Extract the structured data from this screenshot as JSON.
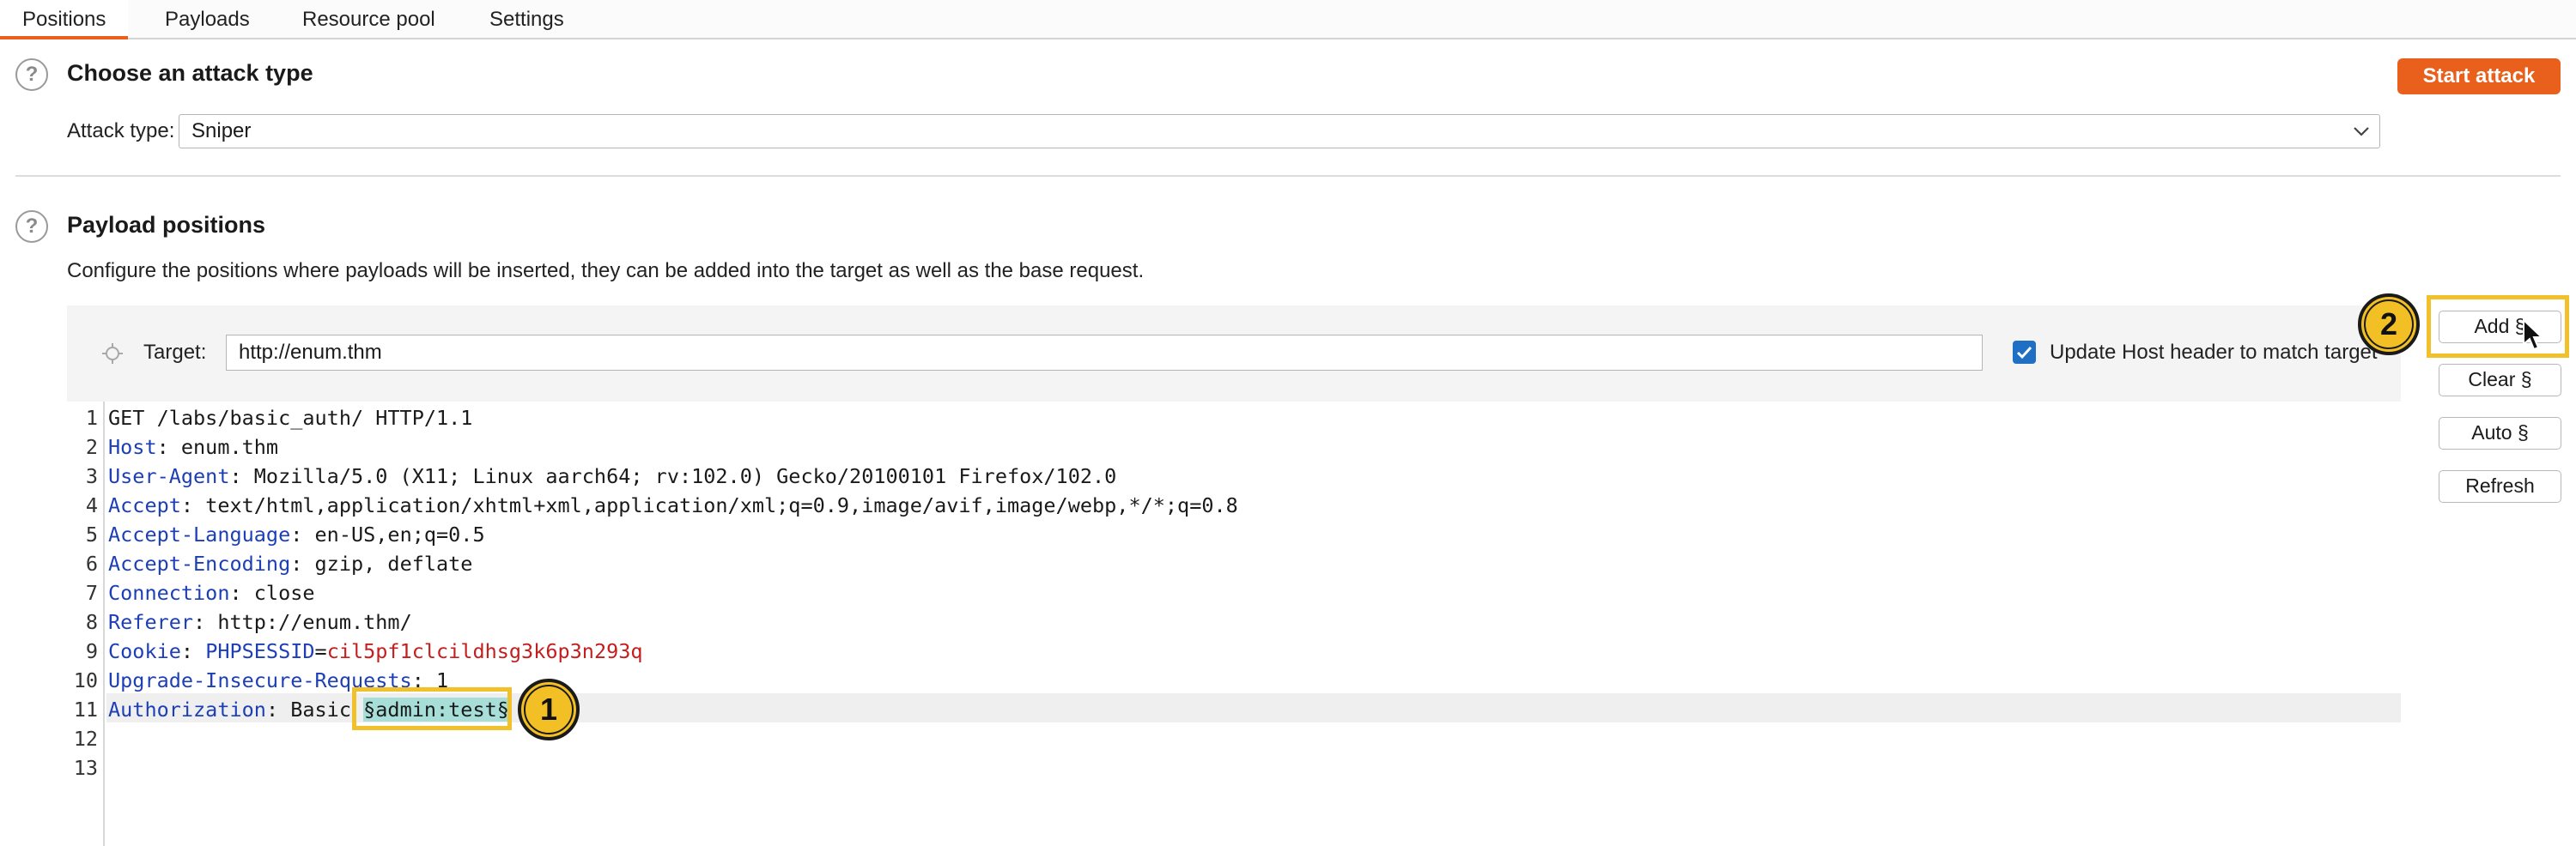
{
  "tabs": [
    "Positions",
    "Payloads",
    "Resource pool",
    "Settings"
  ],
  "attack_section": {
    "title": "Choose an attack type",
    "start_button": "Start attack",
    "attack_type_label": "Attack type:",
    "attack_type_value": "Sniper"
  },
  "payload_section": {
    "title": "Payload positions",
    "description": "Configure the positions where payloads will be inserted, they can be added into the target as well as the base request.",
    "target_label": "Target:",
    "target_value": "http://enum.thm",
    "update_host_label": "Update Host header to match target",
    "update_host_checked": true
  },
  "request_lines": [
    {
      "n": "1",
      "text": "GET /labs/basic_auth/ HTTP/1.1"
    },
    {
      "n": "2",
      "key": "Host",
      "sep": ": ",
      "value": "enum.thm"
    },
    {
      "n": "3",
      "key": "User-Agent",
      "sep": ": ",
      "value": "Mozilla/5.0 (X11; Linux aarch64; rv:102.0) Gecko/20100101 Firefox/102.0"
    },
    {
      "n": "4",
      "key": "Accept",
      "sep": ": ",
      "value": "text/html,application/xhtml+xml,application/xml;q=0.9,image/avif,image/webp,*/*;q=0.8"
    },
    {
      "n": "5",
      "key": "Accept-Language",
      "sep": ": ",
      "value": "en-US,en;q=0.5"
    },
    {
      "n": "6",
      "key": "Accept-Encoding",
      "sep": ": ",
      "value": "gzip, deflate"
    },
    {
      "n": "7",
      "key": "Connection",
      "sep": ": ",
      "value": "close"
    },
    {
      "n": "8",
      "key": "Referer",
      "sep": ": ",
      "value": "http://enum.thm/"
    },
    {
      "n": "9",
      "key": "Cookie",
      "sep": ": ",
      "cookie_name": "PHPSESSID",
      "cookie_eq": "=",
      "cookie_value": "cil5pf1clcildhsg3k6p3n293q"
    },
    {
      "n": "10",
      "key": "Upgrade-Insecure-Requests",
      "sep": ": ",
      "value": "1"
    },
    {
      "n": "11",
      "key": "Authorization",
      "sep": ": ",
      "value": "Basic ",
      "payload": "§admin:test§"
    },
    {
      "n": "12",
      "text": ""
    },
    {
      "n": "13",
      "text": ""
    }
  ],
  "side_buttons": [
    "Add §",
    "Clear §",
    "Auto §",
    "Refresh"
  ],
  "badges": [
    "1",
    "2"
  ],
  "icons": {
    "help": "help-circle-icon",
    "crosshair": "crosshair-icon",
    "chevron": "chevron-down-icon",
    "check": "checkmark-icon",
    "cursor": "mouse-pointer-icon"
  },
  "colors": {
    "accent": "#e8601b",
    "header_key": "#1d3fb5",
    "cookie_value": "#c41e1e",
    "payload_highlight": "#a7ded8",
    "annotation": "#f0c12a"
  }
}
